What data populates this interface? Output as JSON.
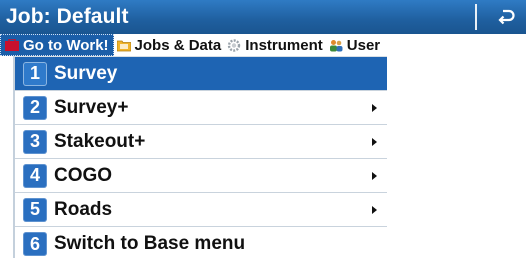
{
  "header": {
    "title": "Job: Default",
    "back_icon": "back-arrow-icon"
  },
  "tabs": [
    {
      "label": "Go to Work!",
      "icon": "work-icon",
      "active": true
    },
    {
      "label": "Jobs & Data",
      "icon": "folder-icon",
      "active": false
    },
    {
      "label": "Instrument",
      "icon": "gear-icon",
      "active": false
    },
    {
      "label": "User",
      "icon": "user-icon",
      "active": false
    }
  ],
  "menu": {
    "items": [
      {
        "number": "1",
        "label": "Survey",
        "has_submenu": false,
        "selected": true
      },
      {
        "number": "2",
        "label": "Survey+",
        "has_submenu": true,
        "selected": false
      },
      {
        "number": "3",
        "label": "Stakeout+",
        "has_submenu": true,
        "selected": false
      },
      {
        "number": "4",
        "label": "COGO",
        "has_submenu": true,
        "selected": false
      },
      {
        "number": "5",
        "label": "Roads",
        "has_submenu": true,
        "selected": false
      },
      {
        "number": "6",
        "label": "Switch to Base menu",
        "has_submenu": false,
        "selected": false
      }
    ]
  },
  "colors": {
    "title_bar": "#1f5f9f",
    "selection": "#1e64b3",
    "number_badge": "#2a6fc0"
  }
}
